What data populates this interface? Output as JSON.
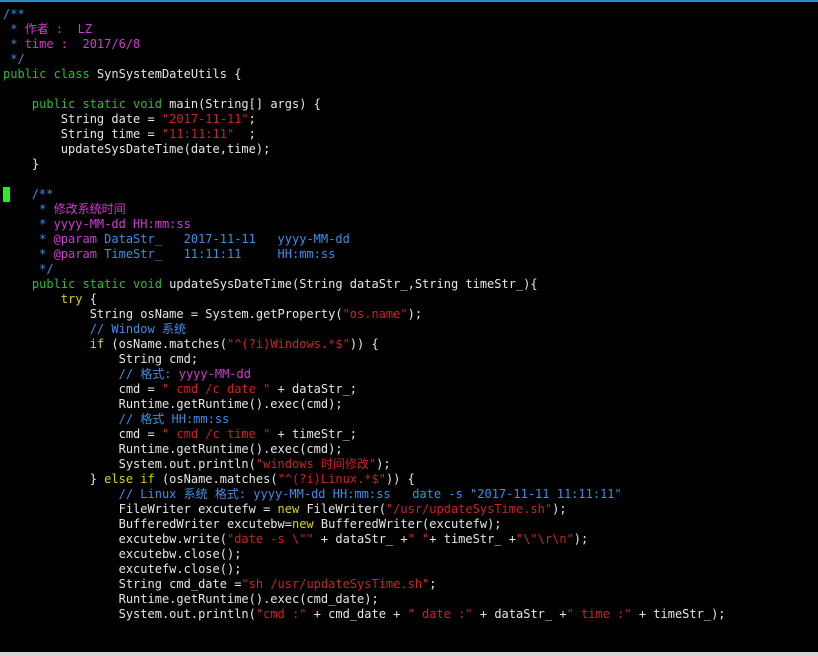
{
  "editor": {
    "lines": [
      [
        {
          "c": "c",
          "t": "/**"
        }
      ],
      [
        {
          "c": "c",
          "t": " * "
        },
        {
          "c": "m",
          "t": "作者 :  LZ"
        }
      ],
      [
        {
          "c": "c",
          "t": " * "
        },
        {
          "c": "m",
          "t": "time :  2017/6/8"
        }
      ],
      [
        {
          "c": "c",
          "t": " */"
        }
      ],
      [
        {
          "c": "k",
          "t": "public class"
        },
        {
          "c": "w",
          "t": " SynSystemDateUtils {"
        }
      ],
      [],
      [
        {
          "c": "w",
          "t": "    "
        },
        {
          "c": "k",
          "t": "public static void"
        },
        {
          "c": "w",
          "t": " main(String[] args) {"
        }
      ],
      [
        {
          "c": "w",
          "t": "        String date = "
        },
        {
          "c": "s",
          "t": "\"2017-11-11\""
        },
        {
          "c": "w",
          "t": ";"
        }
      ],
      [
        {
          "c": "w",
          "t": "        String time = "
        },
        {
          "c": "s",
          "t": "\"11:11:11\""
        },
        {
          "c": "w",
          "t": "  ;"
        }
      ],
      [
        {
          "c": "w",
          "t": "        updateSysDateTime(date,time);"
        }
      ],
      [
        {
          "c": "w",
          "t": "    }"
        }
      ],
      [],
      [
        {
          "c": "cursor",
          "t": ""
        },
        {
          "c": "w",
          "t": "   "
        },
        {
          "c": "c",
          "t": "/**"
        }
      ],
      [
        {
          "c": "c",
          "t": "     * "
        },
        {
          "c": "m",
          "t": "修改系统时间"
        }
      ],
      [
        {
          "c": "c",
          "t": "     * "
        },
        {
          "c": "m",
          "t": "yyyy-MM-dd HH:mm:ss"
        }
      ],
      [
        {
          "c": "c",
          "t": "     * "
        },
        {
          "c": "m",
          "t": "@param"
        },
        {
          "c": "c",
          "t": " DataStr_   2017-11-11   yyyy-MM-dd"
        }
      ],
      [
        {
          "c": "c",
          "t": "     * "
        },
        {
          "c": "m",
          "t": "@param"
        },
        {
          "c": "c",
          "t": " TimeStr_   11:11:11     HH:mm:ss"
        }
      ],
      [
        {
          "c": "c",
          "t": "     */"
        }
      ],
      [
        {
          "c": "w",
          "t": "    "
        },
        {
          "c": "k",
          "t": "public static void"
        },
        {
          "c": "w",
          "t": " updateSysDateTime(String dataStr_,String timeStr_){"
        }
      ],
      [
        {
          "c": "w",
          "t": "        "
        },
        {
          "c": "y",
          "t": "try"
        },
        {
          "c": "w",
          "t": " {"
        }
      ],
      [
        {
          "c": "w",
          "t": "            String osName = System.getProperty("
        },
        {
          "c": "s",
          "t": "\"os.name\""
        },
        {
          "c": "w",
          "t": ");"
        }
      ],
      [
        {
          "c": "w",
          "t": "            "
        },
        {
          "c": "c",
          "t": "// Window 系统"
        }
      ],
      [
        {
          "c": "w",
          "t": "            "
        },
        {
          "c": "y",
          "t": "if"
        },
        {
          "c": "w",
          "t": " (osName.matches("
        },
        {
          "c": "s",
          "t": "\"^(?i)Windows.*$\""
        },
        {
          "c": "w",
          "t": ")) {"
        }
      ],
      [
        {
          "c": "w",
          "t": "                String cmd;"
        }
      ],
      [
        {
          "c": "w",
          "t": "                "
        },
        {
          "c": "c",
          "t": "// 格式: "
        },
        {
          "c": "m",
          "t": "yyyy-MM-dd"
        }
      ],
      [
        {
          "c": "w",
          "t": "                cmd = "
        },
        {
          "c": "s",
          "t": "\" cmd /c date \""
        },
        {
          "c": "w",
          "t": " + dataStr_;"
        }
      ],
      [
        {
          "c": "w",
          "t": "                Runtime.getRuntime().exec(cmd);"
        }
      ],
      [
        {
          "c": "w",
          "t": "                "
        },
        {
          "c": "c",
          "t": "// 格式 HH:mm:ss"
        }
      ],
      [
        {
          "c": "w",
          "t": "                cmd = "
        },
        {
          "c": "s",
          "t": "\" cmd /c time \""
        },
        {
          "c": "w",
          "t": " + timeStr_;"
        }
      ],
      [
        {
          "c": "w",
          "t": "                Runtime.getRuntime().exec(cmd);"
        }
      ],
      [
        {
          "c": "w",
          "t": "                System.out.println("
        },
        {
          "c": "s",
          "t": "\"windows 时间修改\""
        },
        {
          "c": "w",
          "t": ");"
        }
      ],
      [
        {
          "c": "w",
          "t": "            } "
        },
        {
          "c": "y",
          "t": "else if"
        },
        {
          "c": "w",
          "t": " (osName.matches("
        },
        {
          "c": "s",
          "t": "\"^(?i)Linux.*$\""
        },
        {
          "c": "w",
          "t": ")) {"
        }
      ],
      [
        {
          "c": "w",
          "t": "                "
        },
        {
          "c": "c",
          "t": "// Linux 系统 格式: yyyy-MM-dd HH:mm:ss   date -s \"2017-11-11 11:11:11\""
        }
      ],
      [
        {
          "c": "w",
          "t": "                FileWriter excutefw = "
        },
        {
          "c": "y",
          "t": "new"
        },
        {
          "c": "w",
          "t": " FileWriter("
        },
        {
          "c": "s",
          "t": "\"/usr/updateSysTime.sh\""
        },
        {
          "c": "w",
          "t": ");"
        }
      ],
      [
        {
          "c": "w",
          "t": "                BufferedWriter excutebw="
        },
        {
          "c": "y",
          "t": "new"
        },
        {
          "c": "w",
          "t": " BufferedWriter(excutefw);"
        }
      ],
      [
        {
          "c": "w",
          "t": "                excutebw.write("
        },
        {
          "c": "s",
          "t": "\"date -s \\\"\""
        },
        {
          "c": "w",
          "t": " + dataStr_ +"
        },
        {
          "c": "s",
          "t": "\" \""
        },
        {
          "c": "w",
          "t": "+ timeStr_ +"
        },
        {
          "c": "s",
          "t": "\"\\\"\\r\\n\""
        },
        {
          "c": "w",
          "t": ");"
        }
      ],
      [
        {
          "c": "w",
          "t": "                excutebw.close();"
        }
      ],
      [
        {
          "c": "w",
          "t": "                excutefw.close();"
        }
      ],
      [
        {
          "c": "w",
          "t": "                String cmd_date ="
        },
        {
          "c": "s",
          "t": "\"sh /usr/updateSysTime.sh\""
        },
        {
          "c": "w",
          "t": ";"
        }
      ],
      [
        {
          "c": "w",
          "t": "                Runtime.getRuntime().exec(cmd_date);"
        }
      ],
      [
        {
          "c": "w",
          "t": "                System.out.println("
        },
        {
          "c": "s",
          "t": "\"cmd :\""
        },
        {
          "c": "w",
          "t": " + cmd_date + "
        },
        {
          "c": "s",
          "t": "\" date :\""
        },
        {
          "c": "w",
          "t": " + dataStr_ +"
        },
        {
          "c": "s",
          "t": "\" time :\""
        },
        {
          "c": "w",
          "t": " + timeStr_);"
        }
      ]
    ]
  }
}
